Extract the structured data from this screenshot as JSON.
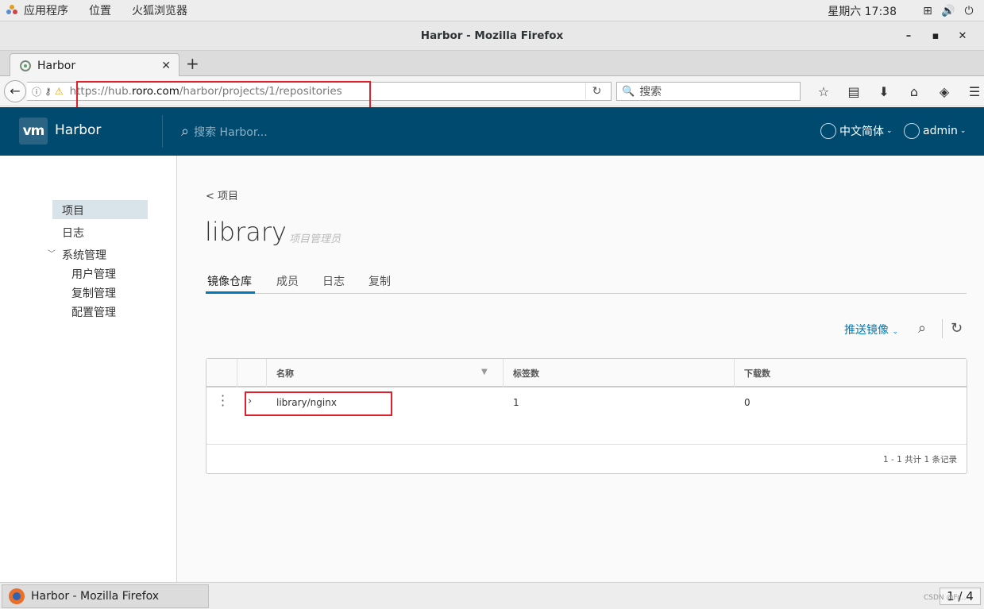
{
  "system": {
    "menu": [
      "应用程序",
      "位置",
      "火狐浏览器"
    ],
    "clock": "星期六 17:38"
  },
  "browser": {
    "window_title": "Harbor - Mozilla Firefox",
    "tab_title": "Harbor",
    "url_prefix": "https://hub.",
    "url_domain": "roro.com",
    "url_path": "/harbor/projects/1/repositories",
    "search_placeholder": "搜索"
  },
  "harbor": {
    "logo": "vm",
    "brand": "Harbor",
    "search_placeholder": "搜索 Harbor...",
    "language": "中文简体",
    "user": "admin"
  },
  "sidebar": {
    "items": [
      "项目",
      "日志",
      "系统管理"
    ],
    "sub_items": [
      "用户管理",
      "复制管理",
      "配置管理"
    ]
  },
  "main": {
    "back_link": "< 项目",
    "project_name": "library",
    "role": "项目管理员",
    "tabs": [
      "镜像仓库",
      "成员",
      "日志",
      "复制"
    ],
    "push_button": "推送镜像",
    "columns": [
      "名称",
      "标签数",
      "下载数"
    ],
    "rows": [
      {
        "name": "library/nginx",
        "tags": "1",
        "pulls": "0"
      }
    ],
    "footer": "1 - 1 共计 1 条记录"
  },
  "taskbar": {
    "window": "Harbor - Mozilla Firefox",
    "pager": "1 / 4"
  },
  "watermark": "CSDN @Fr..."
}
